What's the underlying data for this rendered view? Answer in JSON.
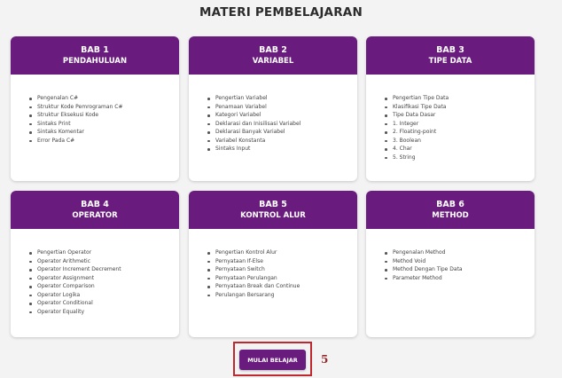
{
  "page": {
    "title": "MATERI PEMBELAJARAN"
  },
  "chapters": [
    {
      "bab": "BAB 1",
      "title": "PENDAHULUAN",
      "topics": [
        "Pengenalan C#",
        "Struktur Kode Pemrograman C#",
        "Struktur Eksekusi Kode",
        "Sintaks Print",
        "Sintaks Komentar",
        "Error Pada C#"
      ]
    },
    {
      "bab": "BAB 2",
      "title": "VARIABEL",
      "topics": [
        "Pengertian Variabel",
        "Penamaan Variabel",
        "Kategori Variabel",
        "Deklarasi dan Inisilisasi Variabel",
        "Deklarasi Banyak Variabel",
        "Variabel Konstanta",
        "Sintaks Input"
      ]
    },
    {
      "bab": "BAB 3",
      "title": "TIPE DATA",
      "topics": [
        "Pengertian Tipe Data",
        "Klasifikasi Tipe Data",
        "Tipe Data Dasar",
        "1. Integer",
        "2. Floating-point",
        "3. Boolean",
        "4. Char",
        "5. String"
      ]
    },
    {
      "bab": "BAB 4",
      "title": "OPERATOR",
      "topics": [
        "Pengertian Operator",
        "Operator Arithmetic",
        "Operator Increment Decrement",
        "Operator Assignment",
        "Operator Comparison",
        "Operator Logika",
        "Operator Conditional",
        "Operator Equality"
      ]
    },
    {
      "bab": "BAB 5",
      "title": "KONTROL ALUR",
      "topics": [
        "Pengertian Kontrol Alur",
        "Pernyataan If-Else",
        "Pernyataan Switch",
        "Pernyataan Perulangan",
        "Pernyataan Break dan Continue",
        "Perulangan Bersarang"
      ]
    },
    {
      "bab": "BAB 6",
      "title": "METHOD",
      "topics": [
        "Pengenalan Method",
        "Method Void",
        "Method Dengan Tipe Data",
        "Parameter Method"
      ]
    }
  ],
  "actions": {
    "start_label": "MULAI BELAJAR"
  },
  "annotation": {
    "number": "5"
  },
  "colors": {
    "brand": "#6a1b7e",
    "highlight": "#c0282f"
  }
}
